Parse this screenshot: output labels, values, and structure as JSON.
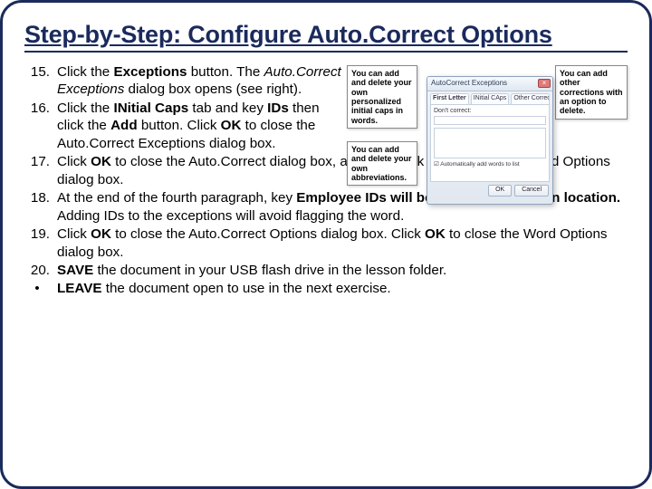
{
  "title": "Step-by-Step: Configure Auto.Correct Options",
  "steps": [
    {
      "num": "15.",
      "narrow": true,
      "segments": [
        {
          "t": " Click the "
        },
        {
          "t": "Exceptions",
          "b": true
        },
        {
          "t": " button. The "
        },
        {
          "t": "Auto.Correct Exceptions",
          "i": true
        },
        {
          "t": " dialog box opens (see right)."
        }
      ]
    },
    {
      "num": "16.",
      "narrow": true,
      "segments": [
        {
          "t": "Click the "
        },
        {
          "t": "INitial Caps",
          "b": true
        },
        {
          "t": " tab and key "
        },
        {
          "t": "IDs",
          "b": true
        },
        {
          "t": " then click the "
        },
        {
          "t": "Add",
          "b": true
        },
        {
          "t": " button. Click "
        },
        {
          "t": "OK",
          "b": true
        },
        {
          "t": " to close the Auto.Correct Exceptions dialog box."
        }
      ]
    },
    {
      "num": "17.",
      "segments": [
        {
          "t": "Click "
        },
        {
          "t": "OK",
          "b": true
        },
        {
          "t": " to close the Auto.Correct dialog box, and then click "
        },
        {
          "t": "OK",
          "b": true
        },
        {
          "t": " to close the Word Options dialog box."
        }
      ]
    },
    {
      "num": "18.",
      "segments": [
        {
          "t": " At the end of the fourth paragraph, key "
        },
        {
          "t": "Employee IDs will be provided to you on location.",
          "b": true
        },
        {
          "t": " Adding IDs to the exceptions will avoid flagging the word."
        }
      ]
    },
    {
      "num": "19.",
      "segments": [
        {
          "t": "Click "
        },
        {
          "t": "OK",
          "b": true
        },
        {
          "t": " to close the Auto.Correct Options dialog box. Click "
        },
        {
          "t": "OK",
          "b": true
        },
        {
          "t": " to close the Word Options dialog box."
        }
      ]
    },
    {
      "num": "20.",
      "segments": [
        {
          "t": "SAVE",
          "b": true
        },
        {
          "t": " the document in your USB flash drive in the lesson folder."
        }
      ]
    }
  ],
  "bullet": {
    "marker": "•",
    "segments": [
      {
        "t": "LEAVE",
        "b": true
      },
      {
        "t": " the document open to use in the next exercise."
      }
    ]
  },
  "callouts": {
    "topLeft": "You can add and delete your own personalized initial caps in words.",
    "topRight": "You can add other corrections with an option to delete.",
    "bottomLeft": "You can add and delete your own abbreviations."
  },
  "dialog": {
    "title": "AutoCorrect Exceptions",
    "tabs": [
      "First Letter",
      "INitial CAps",
      "Other Corrections"
    ],
    "fieldLabel": "Don't correct:",
    "check": "Automatically add words to list",
    "ok": "OK",
    "cancel": "Cancel",
    "close": "×"
  }
}
